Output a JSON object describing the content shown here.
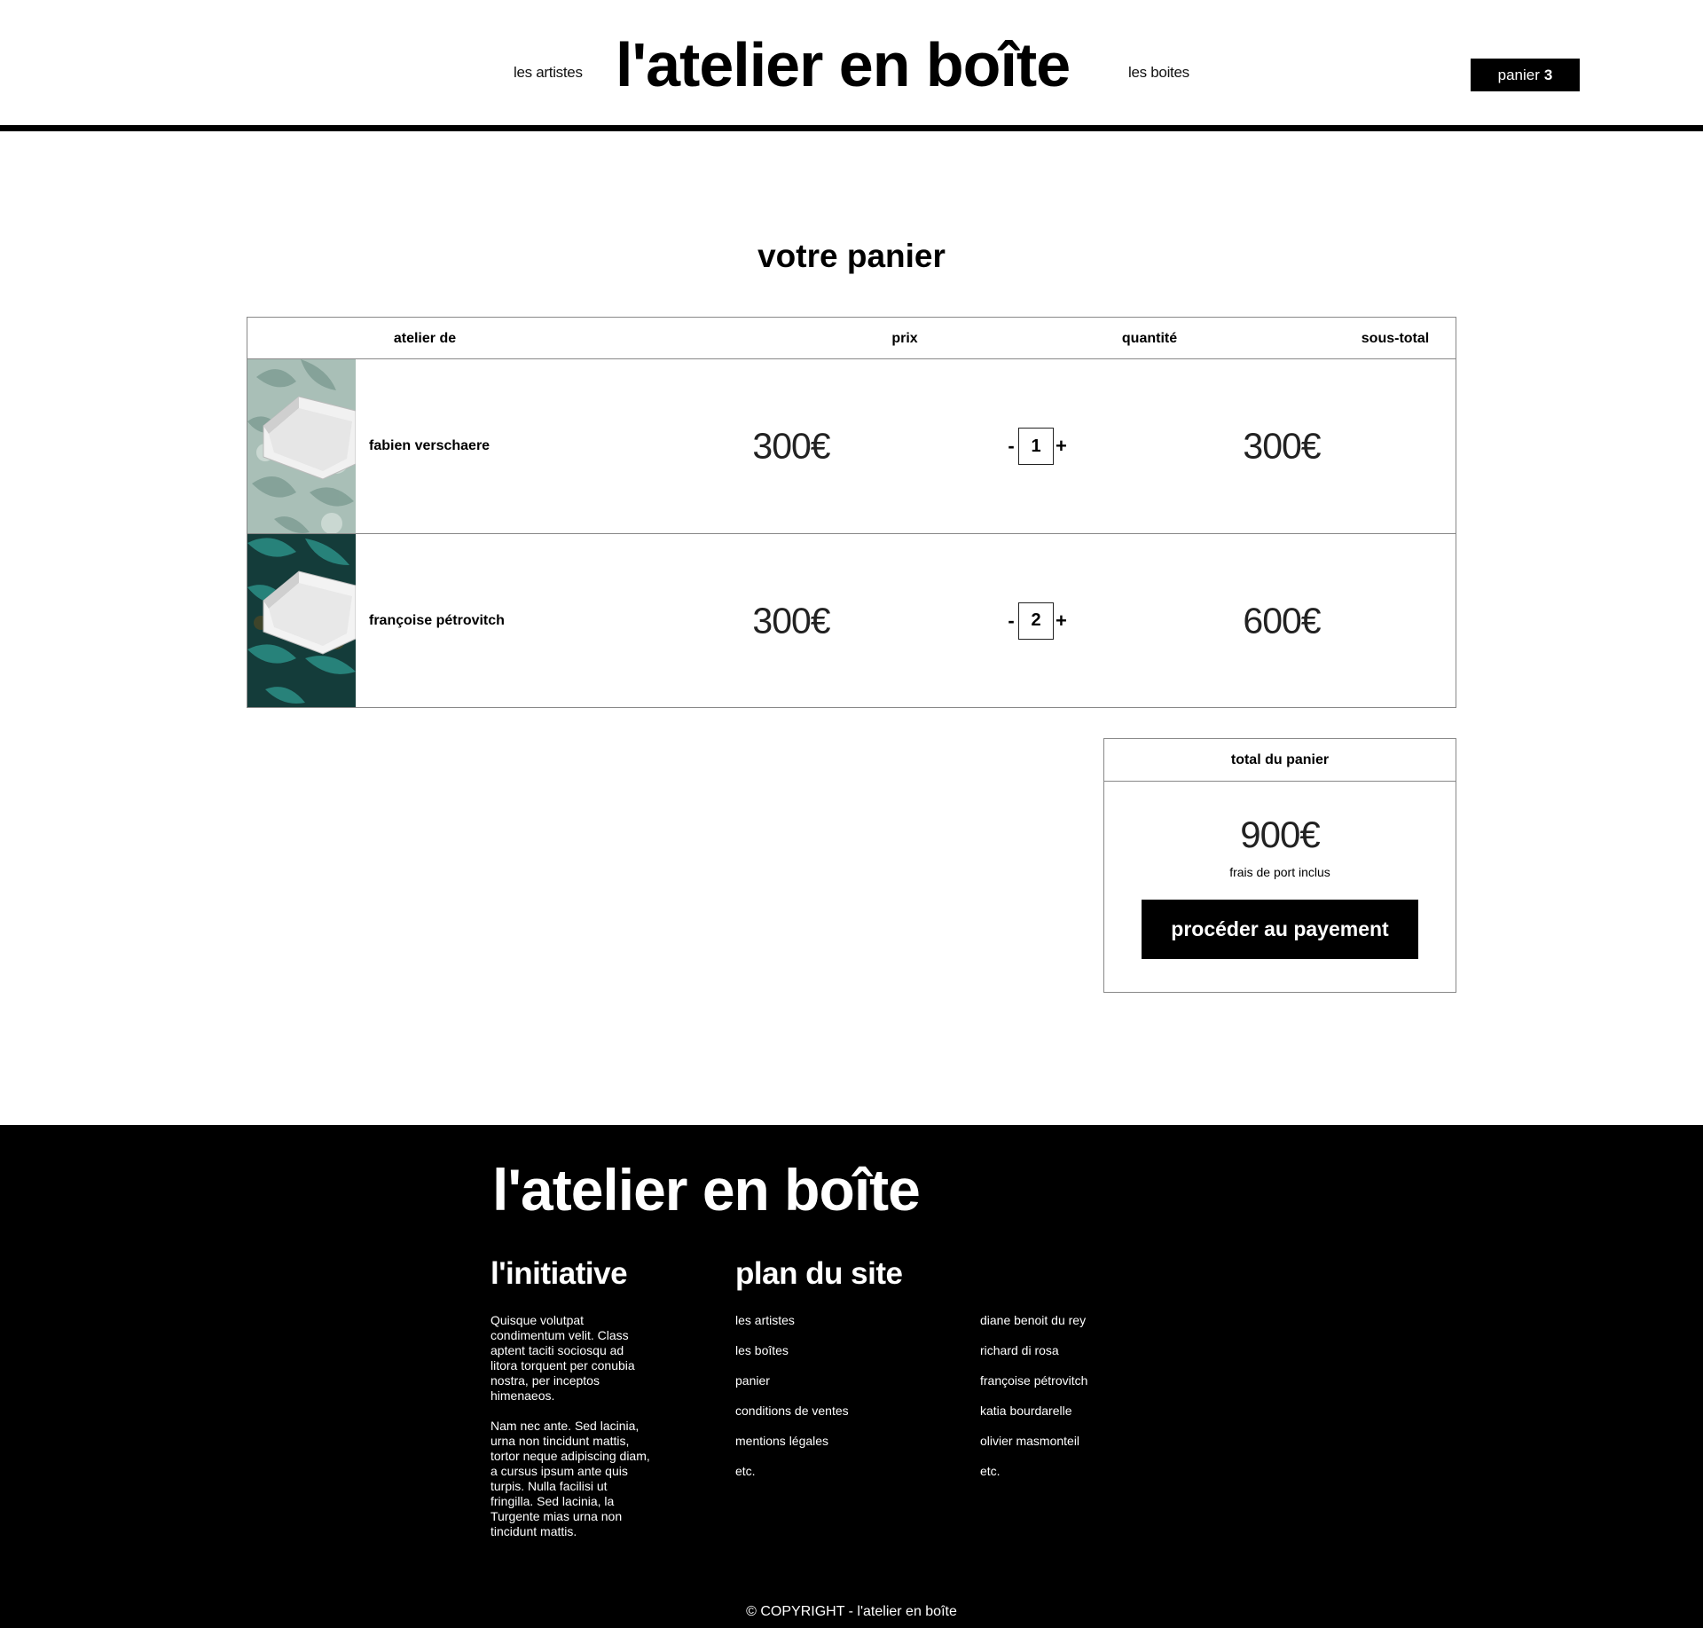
{
  "header": {
    "nav_left": "les artistes",
    "logo": "l'atelier en boîte",
    "nav_right": "les boites",
    "cart_label": "panier",
    "cart_count": "3"
  },
  "page_title": "votre panier",
  "table": {
    "headers": {
      "artist": "atelier de",
      "price": "prix",
      "quantity": "quantité",
      "subtotal": "sous-total"
    },
    "rows": [
      {
        "artist": "fabien verschaere",
        "price": "300€",
        "quantity": "1",
        "subtotal": "300€",
        "minus": "-",
        "plus": "+"
      },
      {
        "artist": "françoise pétrovitch",
        "price": "300€",
        "quantity": "2",
        "subtotal": "600€",
        "minus": "-",
        "plus": "+"
      }
    ]
  },
  "total": {
    "heading": "total du panier",
    "amount": "900€",
    "note": "frais de port inclus",
    "pay_button": "procéder au payement"
  },
  "footer": {
    "logo": "l'atelier en boîte",
    "initiative_heading": "l'initiative",
    "initiative_p1": "Quisque volutpat condimentum velit. Class aptent taciti sociosqu ad litora torquent per conubia nostra, per inceptos himenaeos.",
    "initiative_p2": "Nam nec ante. Sed lacinia, urna non tincidunt mattis, tortor neque adipiscing diam, a cursus ipsum ante quis turpis. Nulla facilisi ut fringilla. Sed lacinia, la Turgente mias urna non tincidunt mattis.",
    "plan_heading": "plan du site",
    "plan_links": [
      "les artistes",
      "les boîtes",
      "panier",
      "conditions de ventes",
      "mentions légales",
      "etc."
    ],
    "artist_links": [
      "diane benoit du rey",
      "richard di rosa",
      "françoise pétrovitch",
      "katia bourdarelle",
      "olivier masmonteil",
      "etc."
    ],
    "copyright": "© COPYRIGHT - l'atelier en boîte"
  },
  "colors": {
    "background": "#ffffff",
    "ink": "#000000",
    "border": "#888888",
    "thumb1_bg": "#9bb3aa",
    "thumb2_bg": "#1b4f4c"
  }
}
